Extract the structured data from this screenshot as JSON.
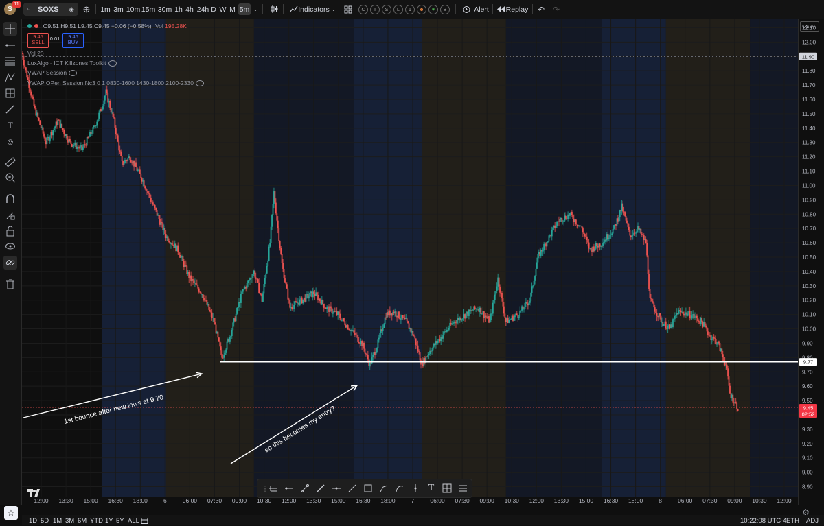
{
  "header": {
    "avatar_initial": "S",
    "notification_count": "11",
    "symbol": "SOXS",
    "intervals": [
      "1m",
      "3m",
      "10m",
      "15m",
      "30m",
      "1h",
      "4h",
      "24h",
      "D",
      "W",
      "M",
      "5m"
    ],
    "active_interval": "5m",
    "indicators_label": "Indicators",
    "template_icons": [
      "C",
      "T",
      "S",
      "L",
      "1",
      "☻",
      "♥",
      "B"
    ],
    "alert_label": "Alert",
    "replay_label": "Replay"
  },
  "legend": {
    "ohlc": "O9.51 H9.51 L9.45 C9.45 −0.06 (−0.58%)",
    "vol_label": "Vol",
    "vol_value": "195.28K",
    "sell_price": "9.45",
    "sell_label": "SELL",
    "spread": "0.01",
    "buy_price": "9.46",
    "buy_label": "BUY",
    "studies": [
      "Vol 20",
      "LuxAlgo - ICT Killzones Toolkit",
      "VWAP Session",
      "VWAP OPen Session Nc3 0 1 0830-1600 1430-1800 2100-2330"
    ]
  },
  "currency": "USD",
  "last_price_tag": {
    "price": "9.45",
    "countdown": "02:52"
  },
  "level_tag": "9.77",
  "dotted_tag": "11.90",
  "annotations": [
    "1st bounce after new lows at 9.70",
    "so this becomes my entry?"
  ],
  "chart_data": {
    "type": "line",
    "style": "candlestick (5m)",
    "symbol": "SOXS",
    "ylim": [
      8.85,
      12.15
    ],
    "y_ticks": [
      "12.10",
      "12.00",
      "11.90",
      "11.80",
      "11.70",
      "11.60",
      "11.50",
      "11.40",
      "11.30",
      "11.20",
      "11.10",
      "11.00",
      "10.90",
      "10.80",
      "10.70",
      "10.60",
      "10.50",
      "10.40",
      "10.30",
      "10.20",
      "10.10",
      "10.00",
      "9.90",
      "9.80",
      "9.70",
      "9.60",
      "9.50",
      "9.40",
      "9.30",
      "9.20",
      "9.10",
      "9.00",
      "8.90"
    ],
    "x_ticks": [
      "12:00",
      "13:30",
      "15:00",
      "16:30",
      "18:00",
      "6",
      "06:00",
      "07:30",
      "09:00",
      "10:30",
      "12:00",
      "13:30",
      "15:00",
      "16:30",
      "18:00",
      "7",
      "06:00",
      "07:30",
      "09:00",
      "10:30",
      "12:00",
      "13:30",
      "15:00",
      "16:30",
      "18:00",
      "8",
      "06:00",
      "07:30",
      "09:00",
      "10:30",
      "12:00"
    ],
    "price_path": [
      {
        "t": 0,
        "v": 11.92
      },
      {
        "t": 3,
        "v": 11.55
      },
      {
        "t": 6,
        "v": 11.3
      },
      {
        "t": 9,
        "v": 11.45
      },
      {
        "t": 12,
        "v": 11.3
      },
      {
        "t": 15,
        "v": 11.25
      },
      {
        "t": 18,
        "v": 11.4
      },
      {
        "t": 20,
        "v": 11.55
      },
      {
        "t": 21,
        "v": 11.65
      },
      {
        "t": 23,
        "v": 11.45
      },
      {
        "t": 25,
        "v": 11.15
      },
      {
        "t": 27,
        "v": 11.2
      },
      {
        "t": 30,
        "v": 11.05
      },
      {
        "t": 33,
        "v": 10.85
      },
      {
        "t": 36,
        "v": 10.65
      },
      {
        "t": 39,
        "v": 10.55
      },
      {
        "t": 42,
        "v": 10.35
      },
      {
        "t": 45,
        "v": 10.25
      },
      {
        "t": 48,
        "v": 10.05
      },
      {
        "t": 50,
        "v": 9.8
      },
      {
        "t": 52,
        "v": 9.95
      },
      {
        "t": 55,
        "v": 10.25
      },
      {
        "t": 58,
        "v": 10.4
      },
      {
        "t": 60,
        "v": 10.2
      },
      {
        "t": 62,
        "v": 10.6
      },
      {
        "t": 63,
        "v": 10.95
      },
      {
        "t": 65,
        "v": 10.45
      },
      {
        "t": 67,
        "v": 10.15
      },
      {
        "t": 70,
        "v": 10.2
      },
      {
        "t": 73,
        "v": 10.25
      },
      {
        "t": 76,
        "v": 10.15
      },
      {
        "t": 79,
        "v": 10.1
      },
      {
        "t": 82,
        "v": 10.0
      },
      {
        "t": 85,
        "v": 9.9
      },
      {
        "t": 87,
        "v": 9.75
      },
      {
        "t": 89,
        "v": 9.9
      },
      {
        "t": 91,
        "v": 10.1
      },
      {
        "t": 93,
        "v": 10.12
      },
      {
        "t": 96,
        "v": 10.05
      },
      {
        "t": 98,
        "v": 9.95
      },
      {
        "t": 100,
        "v": 9.75
      },
      {
        "t": 102,
        "v": 9.85
      },
      {
        "t": 105,
        "v": 9.95
      },
      {
        "t": 108,
        "v": 10.05
      },
      {
        "t": 111,
        "v": 10.1
      },
      {
        "t": 114,
        "v": 10.15
      },
      {
        "t": 117,
        "v": 10.05
      },
      {
        "t": 119,
        "v": 10.35
      },
      {
        "t": 121,
        "v": 10.05
      },
      {
        "t": 124,
        "v": 10.1
      },
      {
        "t": 127,
        "v": 10.2
      },
      {
        "t": 129,
        "v": 10.5
      },
      {
        "t": 132,
        "v": 10.65
      },
      {
        "t": 134,
        "v": 10.75
      },
      {
        "t": 137,
        "v": 10.8
      },
      {
        "t": 140,
        "v": 10.7
      },
      {
        "t": 142,
        "v": 10.55
      },
      {
        "t": 145,
        "v": 10.6
      },
      {
        "t": 148,
        "v": 10.7
      },
      {
        "t": 150,
        "v": 10.85
      },
      {
        "t": 152,
        "v": 10.65
      },
      {
        "t": 154,
        "v": 10.7
      },
      {
        "t": 156,
        "v": 10.6
      },
      {
        "t": 157,
        "v": 10.2
      },
      {
        "t": 160,
        "v": 10.05
      },
      {
        "t": 162,
        "v": 10.0
      },
      {
        "t": 164,
        "v": 10.12
      },
      {
        "t": 167,
        "v": 10.1
      },
      {
        "t": 170,
        "v": 10.05
      },
      {
        "t": 172,
        "v": 9.95
      },
      {
        "t": 174,
        "v": 9.9
      },
      {
        "t": 176,
        "v": 9.75
      },
      {
        "t": 177,
        "v": 9.55
      },
      {
        "t": 179,
        "v": 9.45
      }
    ],
    "t_range": [
      0,
      194
    ],
    "horizontal_line": 9.77,
    "dotted_line": 11.9,
    "session_bands": [
      {
        "from": 20,
        "to": 36,
        "color": "#1a2744"
      },
      {
        "from": 36,
        "to": 58,
        "color": "#2a261d"
      },
      {
        "from": 58,
        "to": 83,
        "color": "#151c2e"
      },
      {
        "from": 83,
        "to": 100,
        "color": "#1a2744"
      },
      {
        "from": 100,
        "to": 121,
        "color": "#2a261d"
      },
      {
        "from": 121,
        "to": 145,
        "color": "#151c2e"
      },
      {
        "from": 145,
        "to": 161,
        "color": "#1a2744"
      },
      {
        "from": 161,
        "to": 182,
        "color": "#2a261d"
      },
      {
        "from": 182,
        "to": 194,
        "color": "#151c2e"
      }
    ],
    "up_color": "#26a69a",
    "down_color": "#ef5350"
  },
  "drawing_toolbar": [
    "hline-tool-icon",
    "ray-tool-icon",
    "trendline-tool-icon",
    "brush-tool-icon",
    "hline2-tool-icon",
    "line-tool-icon",
    "rect-tool-icon",
    "path-tool-icon",
    "curve-tool-icon",
    "vline-tool-icon",
    "text-tool-icon",
    "measure-tool-icon",
    "fib-tool-icon"
  ],
  "bottom": {
    "ranges": [
      "1D",
      "5D",
      "1M",
      "3M",
      "6M",
      "YTD",
      "1Y",
      "5Y",
      "All"
    ],
    "time": "10:22:08 UTC-4",
    "session": "ETH",
    "adj": "ADJ"
  }
}
